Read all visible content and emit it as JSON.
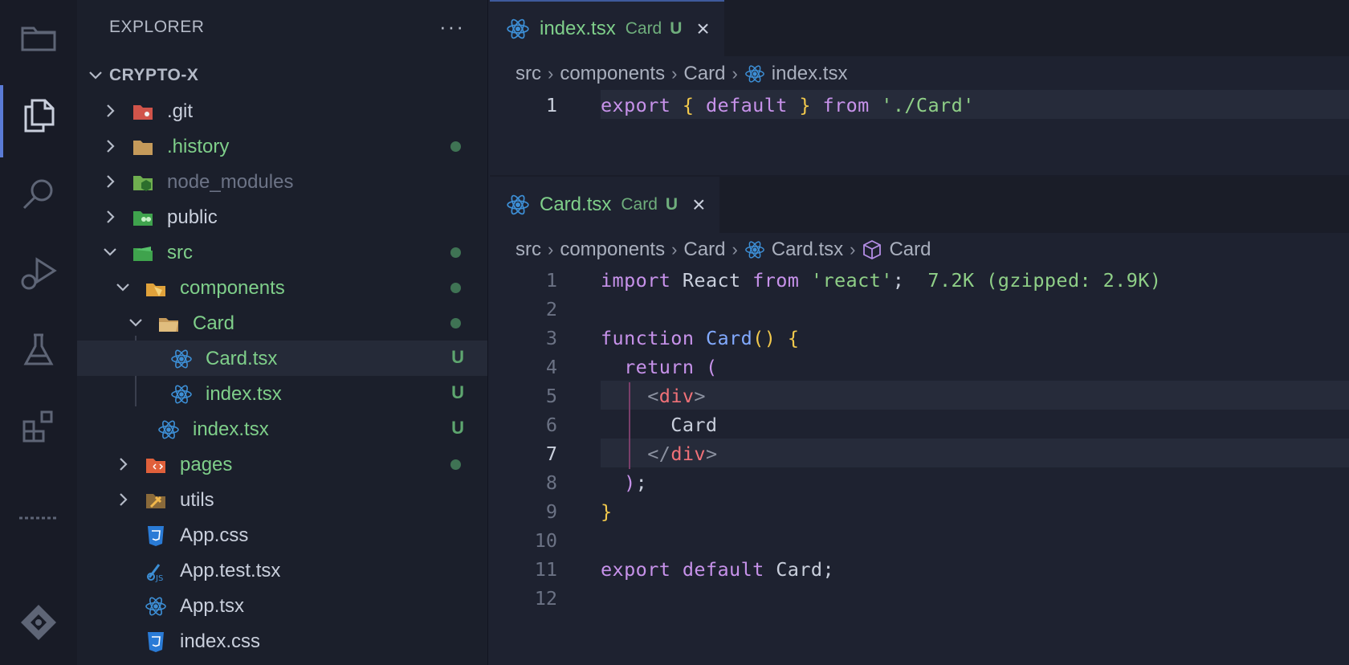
{
  "sidebar": {
    "title": "EXPLORER",
    "more": "···",
    "root": "CRYPTO-X",
    "items": [
      {
        "label": ".git",
        "status": ""
      },
      {
        "label": ".history",
        "status": "dot"
      },
      {
        "label": "node_modules",
        "status": ""
      },
      {
        "label": "public",
        "status": ""
      },
      {
        "label": "src",
        "status": "dot"
      },
      {
        "label": "components",
        "status": "dot"
      },
      {
        "label": "Card",
        "status": "dot"
      },
      {
        "label": "Card.tsx",
        "status": "U"
      },
      {
        "label": "index.tsx",
        "status": "U"
      },
      {
        "label": "index.tsx",
        "status": "U"
      },
      {
        "label": "pages",
        "status": "dot"
      },
      {
        "label": "utils",
        "status": ""
      },
      {
        "label": "App.css",
        "status": ""
      },
      {
        "label": "App.test.tsx",
        "status": ""
      },
      {
        "label": "App.tsx",
        "status": ""
      },
      {
        "label": "index.css",
        "status": ""
      }
    ]
  },
  "editor_top": {
    "tab": {
      "name": "index.tsx",
      "desc": "Card",
      "status": "U",
      "close": "×"
    },
    "breadcrumb": [
      "src",
      "components",
      "Card",
      "index.tsx"
    ],
    "lines": [
      {
        "n": "1",
        "parts": [
          [
            "k",
            "export"
          ],
          [
            "",
            " "
          ],
          [
            "y",
            "{"
          ],
          [
            "",
            " "
          ],
          [
            "k",
            "default"
          ],
          [
            "",
            " "
          ],
          [
            "y",
            "}"
          ],
          [
            "",
            " "
          ],
          [
            "k",
            "from"
          ],
          [
            "",
            " "
          ],
          [
            "s",
            "'./Card'"
          ]
        ]
      }
    ]
  },
  "editor_bottom": {
    "tab": {
      "name": "Card.tsx",
      "desc": "Card",
      "status": "U",
      "close": "×"
    },
    "breadcrumb": [
      "src",
      "components",
      "Card",
      "Card.tsx",
      "Card"
    ],
    "lines": [
      {
        "n": "1",
        "parts": [
          [
            "k",
            "import"
          ],
          [
            "",
            " React "
          ],
          [
            "k",
            "from"
          ],
          [
            "",
            " "
          ],
          [
            "s",
            "'react'"
          ],
          [
            "",
            ";  "
          ],
          [
            "ann",
            "7.2K (gzipped: 2.9K)"
          ]
        ]
      },
      {
        "n": "2",
        "parts": []
      },
      {
        "n": "3",
        "parts": [
          [
            "k",
            "function"
          ],
          [
            "",
            " "
          ],
          [
            "f",
            "Card"
          ],
          [
            "y",
            "()"
          ],
          [
            "",
            " "
          ],
          [
            "y",
            "{"
          ]
        ]
      },
      {
        "n": "4",
        "parts": [
          [
            "",
            "  "
          ],
          [
            "k",
            "return"
          ],
          [
            "",
            " "
          ],
          [
            "p",
            "("
          ]
        ]
      },
      {
        "n": "5",
        "parts": [
          [
            "",
            "    "
          ],
          [
            "g",
            "<"
          ],
          [
            "t",
            "div"
          ],
          [
            "g",
            ">"
          ]
        ]
      },
      {
        "n": "6",
        "parts": [
          [
            "",
            "      Card"
          ]
        ]
      },
      {
        "n": "7",
        "parts": [
          [
            "",
            "    "
          ],
          [
            "g",
            "</"
          ],
          [
            "t",
            "div"
          ],
          [
            "g",
            ">"
          ]
        ]
      },
      {
        "n": "8",
        "parts": [
          [
            "",
            "  "
          ],
          [
            "p",
            ")"
          ],
          [
            "",
            ";"
          ]
        ]
      },
      {
        "n": "9",
        "parts": [
          [
            "y",
            "}"
          ]
        ]
      },
      {
        "n": "10",
        "parts": []
      },
      {
        "n": "11",
        "parts": [
          [
            "k",
            "export"
          ],
          [
            "",
            " "
          ],
          [
            "k",
            "default"
          ],
          [
            "",
            " Card;"
          ]
        ]
      },
      {
        "n": "12",
        "parts": []
      }
    ]
  },
  "colors": {
    "accent": "#5a7bd6",
    "git_added": "#7fcf8a",
    "background": "#1e2230"
  }
}
